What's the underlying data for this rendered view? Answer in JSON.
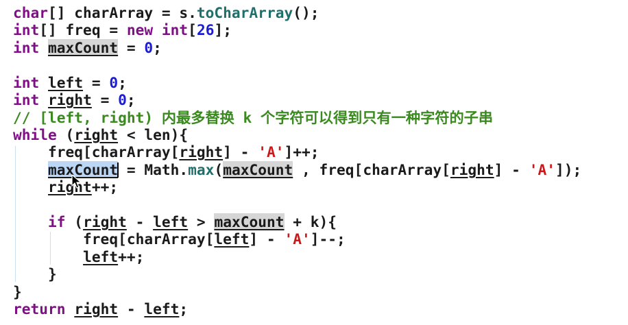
{
  "editor": {
    "lines": [
      {
        "id": "L1",
        "tokens": [
          {
            "t": "char",
            "c": "kw"
          },
          {
            "t": "[] charArray = s."
          },
          {
            "t": "toCharArray",
            "c": "method"
          },
          {
            "t": "();"
          }
        ]
      },
      {
        "id": "L2",
        "tokens": [
          {
            "t": "int",
            "c": "kw"
          },
          {
            "t": "[] freq = "
          },
          {
            "t": "new",
            "c": "kw"
          },
          {
            "t": " "
          },
          {
            "t": "int",
            "c": "kw"
          },
          {
            "t": "["
          },
          {
            "t": "26",
            "c": "num"
          },
          {
            "t": "];"
          }
        ]
      },
      {
        "id": "L3",
        "tokens": [
          {
            "t": "int",
            "c": "kw"
          },
          {
            "t": " "
          },
          {
            "t": "maxCount",
            "c": "var hl"
          },
          {
            "t": " = "
          },
          {
            "t": "0",
            "c": "num"
          },
          {
            "t": ";"
          }
        ]
      },
      {
        "id": "L4",
        "tokens": []
      },
      {
        "id": "L5",
        "tokens": [
          {
            "t": "int",
            "c": "kw"
          },
          {
            "t": " "
          },
          {
            "t": "left",
            "c": "var"
          },
          {
            "t": " = "
          },
          {
            "t": "0",
            "c": "num"
          },
          {
            "t": ";"
          }
        ]
      },
      {
        "id": "L6",
        "tokens": [
          {
            "t": "int",
            "c": "kw"
          },
          {
            "t": " "
          },
          {
            "t": "right",
            "c": "var"
          },
          {
            "t": " = "
          },
          {
            "t": "0",
            "c": "num"
          },
          {
            "t": ";"
          }
        ]
      },
      {
        "id": "L7",
        "tokens": [
          {
            "t": "// [left, right) 内最多替换 k 个字符可以得到只有一种字符的子串",
            "c": "cm"
          }
        ]
      },
      {
        "id": "L8",
        "tokens": [
          {
            "t": "while",
            "c": "kw"
          },
          {
            "t": " ("
          },
          {
            "t": "right",
            "c": "var"
          },
          {
            "t": " < len){"
          }
        ]
      },
      {
        "id": "L9",
        "tokens": [
          {
            "t": "    freq[charArray["
          },
          {
            "t": "right",
            "c": "var"
          },
          {
            "t": "] - "
          },
          {
            "t": "'A'",
            "c": "str"
          },
          {
            "t": "]++;"
          }
        ]
      },
      {
        "id": "L10",
        "tokens": [
          {
            "t": "    "
          },
          {
            "t": "maxCount",
            "c": "var sel"
          },
          {
            "t": "",
            "c": "caret"
          },
          {
            "t": " = Math."
          },
          {
            "t": "max",
            "c": "method"
          },
          {
            "t": "("
          },
          {
            "t": "maxCount",
            "c": "var hl"
          },
          {
            "t": " , freq[charArray["
          },
          {
            "t": "right",
            "c": "var"
          },
          {
            "t": "] - "
          },
          {
            "t": "'A'",
            "c": "str"
          },
          {
            "t": "]);"
          }
        ]
      },
      {
        "id": "L11",
        "tokens": [
          {
            "t": "    "
          },
          {
            "t": "right",
            "c": "var"
          },
          {
            "t": "++;"
          }
        ]
      },
      {
        "id": "L12",
        "tokens": []
      },
      {
        "id": "L13",
        "tokens": [
          {
            "t": "    "
          },
          {
            "t": "if",
            "c": "kw"
          },
          {
            "t": " ("
          },
          {
            "t": "right",
            "c": "var"
          },
          {
            "t": " - "
          },
          {
            "t": "left",
            "c": "var"
          },
          {
            "t": " > "
          },
          {
            "t": "maxCount",
            "c": "var hl"
          },
          {
            "t": " + k){"
          }
        ]
      },
      {
        "id": "L14",
        "tokens": [
          {
            "t": "        freq[charArray["
          },
          {
            "t": "left",
            "c": "var"
          },
          {
            "t": "] - "
          },
          {
            "t": "'A'",
            "c": "str"
          },
          {
            "t": "]--;"
          }
        ]
      },
      {
        "id": "L15",
        "tokens": [
          {
            "t": "        "
          },
          {
            "t": "left",
            "c": "var"
          },
          {
            "t": "++;"
          }
        ]
      },
      {
        "id": "L16",
        "tokens": [
          {
            "t": "    }"
          }
        ]
      },
      {
        "id": "L17",
        "tokens": [
          {
            "t": "}"
          }
        ]
      },
      {
        "id": "L18",
        "tokens": [
          {
            "t": "return",
            "c": "kw"
          },
          {
            "t": " "
          },
          {
            "t": "right",
            "c": "var"
          },
          {
            "t": " - "
          },
          {
            "t": "left",
            "c": "var"
          },
          {
            "t": ";"
          }
        ]
      }
    ]
  },
  "colors": {
    "keyword": "#7f0f85",
    "number": "#1c1cd0",
    "string": "#cc1818",
    "comment": "#3a8a1f",
    "method": "#1f6f6b",
    "occurrence_highlight": "#d6d6d6",
    "selection": "#bcd6f5"
  },
  "icons": {
    "cursor": "mouse-pointer-icon"
  }
}
